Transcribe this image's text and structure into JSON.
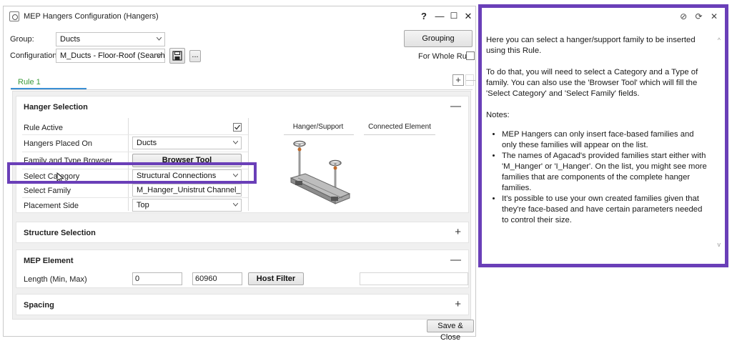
{
  "window": {
    "title": "MEP Hangers Configuration (Hangers)",
    "help_btn": "?",
    "minimize_btn": "—",
    "maximize_btn": "☐",
    "close_btn": "✕"
  },
  "top": {
    "group_label": "Group:",
    "group_value": "Ducts",
    "config_label": "Configuration:",
    "config_value": "M_Ducts - Floor-Roof (Search To",
    "more_btn": "...",
    "grouping_btn": "Grouping",
    "whole_run_label": "For Whole Run:"
  },
  "tabs": {
    "rule1": "Rule 1",
    "add": "+",
    "remove": "—"
  },
  "hanger_selection": {
    "title": "Hanger Selection",
    "toggle": "—",
    "rows": {
      "rule_active": "Rule Active",
      "placed_on": "Hangers Placed On",
      "placed_on_value": "Ducts",
      "browser": "Family and Type Browser",
      "browser_btn": "Browser Tool",
      "category": "Select Category",
      "category_value": "Structural Connections",
      "family": "Select Family",
      "family_value": "M_Hanger_Unistrut Channel_Uni",
      "side": "Placement Side",
      "side_value": "Top"
    },
    "col_hanger": "Hanger/Support",
    "col_connected": "Connected Element"
  },
  "structure_selection": {
    "title": "Structure Selection",
    "toggle": "+"
  },
  "mep_element": {
    "title": "MEP Element",
    "toggle": "—",
    "length_label": "Length (Min, Max)",
    "min": "0",
    "max": "60960",
    "host_filter_btn": "Host Filter"
  },
  "spacing": {
    "title": "Spacing",
    "toggle": "+"
  },
  "footer": {
    "save_close": "Save & Close"
  },
  "help": {
    "icons": {
      "hide": "⊘",
      "refresh": "⟳",
      "close": "✕"
    },
    "p1": "Here you can select a hanger/support family to be inserted using this Rule.",
    "p2": "To do that, you will need to select a Category and a Type of family. You can also use the 'Browser Tool' which will fill the 'Select Category' and 'Select Family' fields.",
    "p3": "Notes:",
    "bullets": [
      "MEP Hangers can only insert face-based families and only these families will appear on the list.",
      "The names of Agacad's provided families start either with 'M_Hanger' or 'I_Hanger'. On the list, you might see more families that are components of the complete hanger families.",
      "It's possible to use your own created families given that they're face-based and have certain parameters needed to control their size."
    ],
    "scroll_up": "^",
    "scroll_down": "v"
  },
  "colors": {
    "accent_purple": "#6a3fb8",
    "tab_green": "#3a9a3a",
    "tab_blue": "#3a8fd4"
  }
}
